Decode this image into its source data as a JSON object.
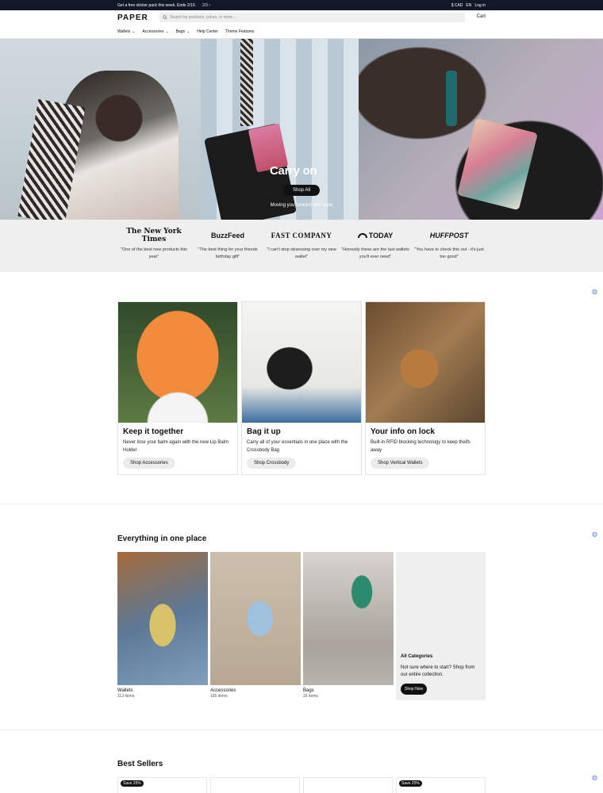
{
  "announcement": {
    "text": "Get a free sticker pack this week. Ends 2/10.",
    "pager": "2/3 ›",
    "currency": "$ CAD",
    "language": "EN",
    "login": "Log in"
  },
  "header": {
    "logo": "PAPER",
    "search_placeholder": "Search by products, colors, or more...",
    "cart": "Cart"
  },
  "menu": [
    {
      "label": "Wallets",
      "dropdown": true
    },
    {
      "label": "Accessories",
      "dropdown": true
    },
    {
      "label": "Bags",
      "dropdown": true
    },
    {
      "label": "Help Center",
      "dropdown": false
    },
    {
      "label": "Theme Features",
      "dropdown": false
    }
  ],
  "hero": {
    "title": "Carry on",
    "button": "Shop All",
    "subtitle": "Moving you forward with style"
  },
  "press": [
    {
      "logo": "The New York Times",
      "quote": "\"One of the best new products this year\""
    },
    {
      "logo": "BuzzFeed",
      "quote": "\"The best thing for your friends birthday gift\""
    },
    {
      "logo": "FAST COMPANY",
      "quote": "\"I can't stop obsessing over my new wallet\""
    },
    {
      "logo": "TODAY",
      "quote": "\"Honestly these are the last wallets you'll ever need\""
    },
    {
      "logo": "HUFFPOST",
      "quote": "\"You have to check this out - it's just too good\""
    }
  ],
  "features": [
    {
      "title": "Keep it together",
      "text": "Never lose your balm again with the new Lip Balm Holder",
      "button": "Shop Accessories"
    },
    {
      "title": "Bag it up",
      "text": "Carry all of your essentials in one place with the Crossbody Bag",
      "button": "Shop Crossbody"
    },
    {
      "title": "Your info on lock",
      "text": "Built-in RFID blocking technology to keep theifs away",
      "button": "Shop Vertical Wallets"
    }
  ],
  "categories": {
    "title": "Everything in one place",
    "items": [
      {
        "name": "Wallets",
        "count": "113 items"
      },
      {
        "name": "Accessories",
        "count": "165 items"
      },
      {
        "name": "Bags",
        "count": "26 items"
      }
    ],
    "all": {
      "title": "All Categories",
      "text": "Not sure where to start? Shop from our entire collection.",
      "button": "Shop Now"
    }
  },
  "best_sellers": {
    "title": "Best Sellers",
    "tags": [
      "Save 25%",
      "",
      "",
      "Save 25%"
    ]
  },
  "colors": {
    "dark": "#111827",
    "panel": "#efefef",
    "accent": "#5a7ee6"
  }
}
